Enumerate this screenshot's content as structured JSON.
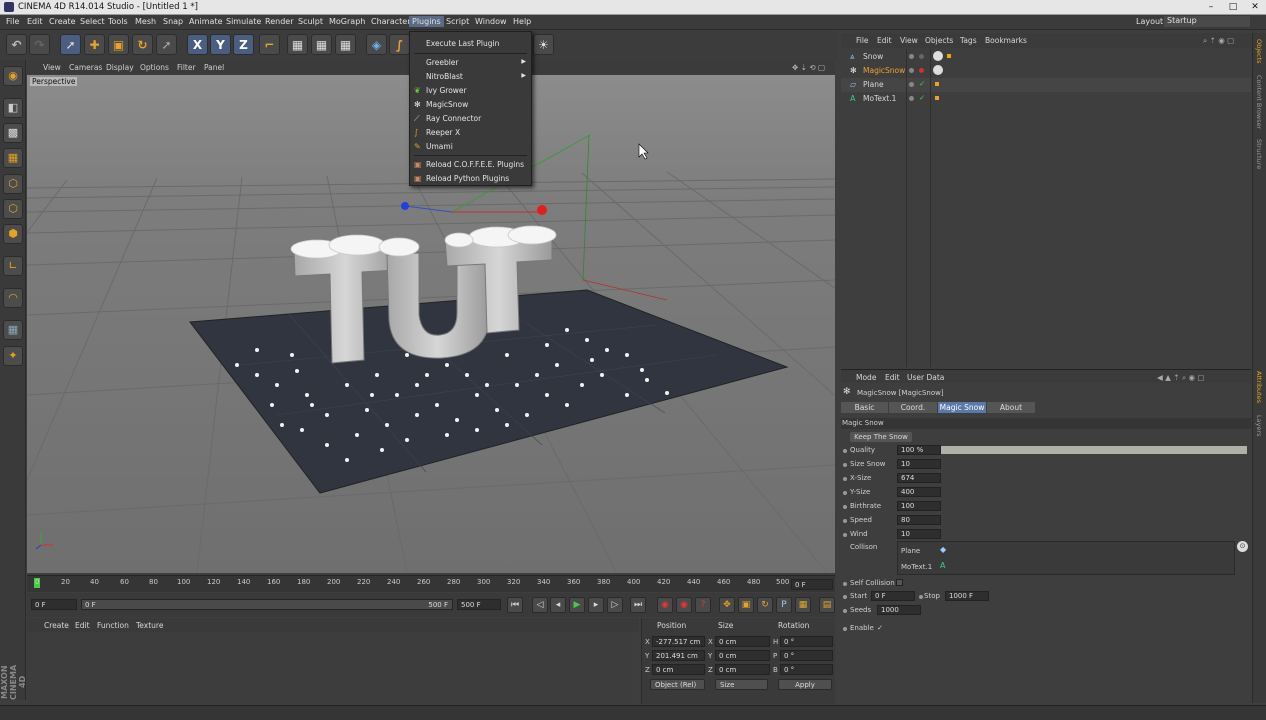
{
  "window": {
    "title": "CINEMA 4D R14.014 Studio - [Untitled 1 *]",
    "layout_label": "Layout:",
    "layout_value": "Startup"
  },
  "menu": [
    "File",
    "Edit",
    "Create",
    "Select",
    "Tools",
    "Mesh",
    "Snap",
    "Animate",
    "Simulate",
    "Render",
    "Sculpt",
    "MoGraph",
    "Character",
    "Plugins",
    "Script",
    "Window",
    "Help"
  ],
  "plugins_menu": {
    "items": [
      {
        "label": "Execute Last Plugin",
        "icon": "",
        "submenu": false
      },
      {
        "label": "Greebler",
        "icon": "",
        "submenu": true
      },
      {
        "label": "NitroBlast",
        "icon": "",
        "submenu": true
      },
      {
        "label": "Ivy Grower",
        "icon": "leaf-icon",
        "submenu": false
      },
      {
        "label": "MagicSnow",
        "icon": "snowflake-icon",
        "submenu": false
      },
      {
        "label": "Ray Connector",
        "icon": "ray-icon",
        "submenu": false
      },
      {
        "label": "Reeper X",
        "icon": "rope-icon",
        "submenu": false
      },
      {
        "label": "Umami",
        "icon": "umami-icon",
        "submenu": false
      },
      {
        "label": "Reload C.O.F.F.E.E. Plugins",
        "icon": "reload-icon",
        "submenu": false
      },
      {
        "label": "Reload Python Plugins",
        "icon": "reload-icon",
        "submenu": false
      }
    ]
  },
  "viewport": {
    "menu": [
      "View",
      "Cameras",
      "Display",
      "Options",
      "Filter",
      "Panel"
    ],
    "label": "Perspective",
    "scene_text": "TUT"
  },
  "timeline": {
    "ticks": [
      "0",
      "20",
      "40",
      "60",
      "80",
      "100",
      "120",
      "140",
      "160",
      "180",
      "200",
      "220",
      "240",
      "260",
      "280",
      "300",
      "320",
      "340",
      "360",
      "380",
      "400",
      "420",
      "440",
      "460",
      "480",
      "500"
    ],
    "current_frame": "0 F",
    "start": "0 F",
    "slider_start": "0 F",
    "slider_end": "500 F",
    "end": "500 F"
  },
  "material_menu": [
    "Create",
    "Edit",
    "Function",
    "Texture"
  ],
  "coords": {
    "headers": [
      "Position",
      "Size",
      "Rotation"
    ],
    "rows": [
      {
        "axis": "X",
        "pos": "-277.517 cm",
        "saxis": "X",
        "size": "0 cm",
        "raxis": "H",
        "rot": "0 °"
      },
      {
        "axis": "Y",
        "pos": "201.491 cm",
        "saxis": "Y",
        "size": "0 cm",
        "raxis": "P",
        "rot": "0 °"
      },
      {
        "axis": "Z",
        "pos": "0 cm",
        "saxis": "Z",
        "size": "0 cm",
        "raxis": "B",
        "rot": "0 °"
      }
    ],
    "mode": "Object (Rel)",
    "size_mode": "Size",
    "apply": "Apply"
  },
  "objects_menu": [
    "File",
    "Edit",
    "View",
    "Objects",
    "Tags",
    "Bookmarks"
  ],
  "objects": [
    {
      "name": "Snow",
      "icon": "snow-icon",
      "selected": false
    },
    {
      "name": "MagicSnow",
      "icon": "snowflake-icon",
      "selected": true
    },
    {
      "name": "Plane",
      "icon": "plane-icon",
      "selected": false
    },
    {
      "name": "MoText.1",
      "icon": "motext-icon",
      "selected": false
    }
  ],
  "side_tabs": [
    "Objects",
    "Content Browser",
    "Structure",
    "Attributes",
    "Layers"
  ],
  "attributes": {
    "menu": [
      "Mode",
      "Edit",
      "User Data"
    ],
    "object_title": "MagicSnow [MagicSnow]",
    "tabs": [
      "Basic",
      "Coord.",
      "Magic Snow",
      "About"
    ],
    "active_tab": "Magic Snow",
    "section": "Magic Snow",
    "keep_button": "Keep The Snow",
    "params": [
      {
        "label": "Quality",
        "value": "100 %"
      },
      {
        "label": "Size Snow",
        "value": "10"
      },
      {
        "label": "X-Size",
        "value": "674"
      },
      {
        "label": "Y-Size",
        "value": "400"
      },
      {
        "label": "Birthrate",
        "value": "100"
      },
      {
        "label": "Speed",
        "value": "80"
      },
      {
        "label": "Wind",
        "value": "10"
      }
    ],
    "quality_fraction": 1.0,
    "collision_label": "Collison",
    "collision_items": [
      "Plane",
      "MoText.1"
    ],
    "self_collision": "Self Collision",
    "start_label": "Start",
    "start_value": "0 F",
    "stop_label": "Stop",
    "stop_value": "1000 F",
    "seeds_label": "Seeds",
    "seeds_value": "1000",
    "enable_label": "Enable",
    "enable_check": "✓"
  },
  "branding": "MAXON CINEMA 4D"
}
